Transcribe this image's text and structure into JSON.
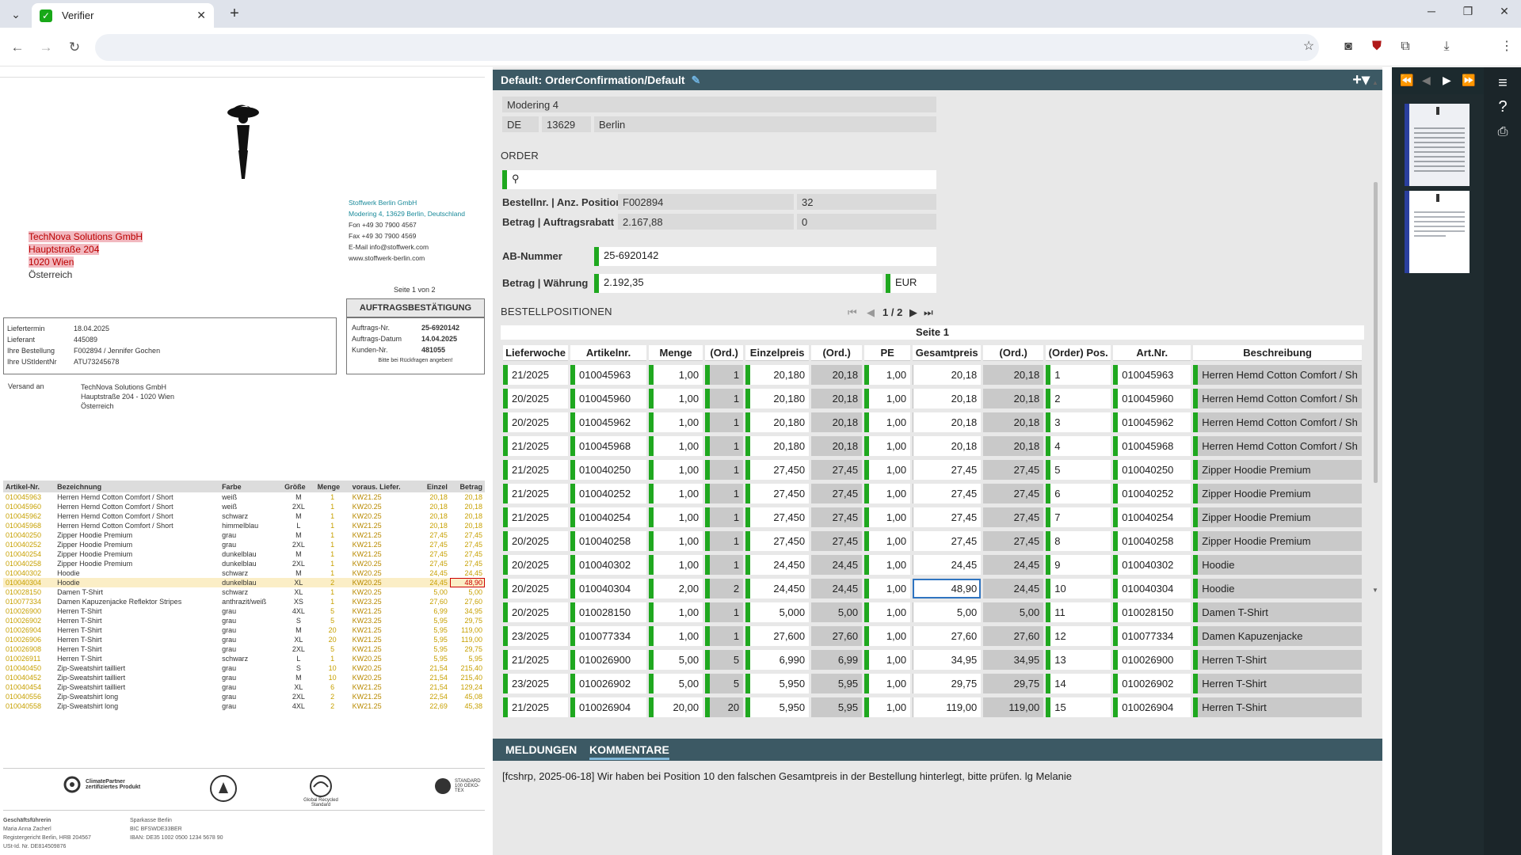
{
  "browser": {
    "tab_title": "Verifier",
    "tab_close": "✕",
    "new_tab": "+"
  },
  "document": {
    "supplier": {
      "name": "Stoffwerk Berlin GmbH",
      "address": "Modering 4, 13629 Berlin, Deutschland",
      "fon": "Fon +49 30 7900 4567",
      "fax": "Fax +49 30 7900 4569",
      "email": "E-Mail info@stoffwerk.com",
      "web": "www.stoffwerk-berlin.com"
    },
    "recipient": [
      "TechNova Solutions GmbH",
      "Hauptstraße 204",
      "1020 Wien",
      "Österreich"
    ],
    "page_info": "Seite 1 von 2",
    "doc_title": "AUFTRAGSBESTÄTIGUNG",
    "left_fields": [
      {
        "label": "Liefertermin",
        "value": "18.04.2025"
      },
      {
        "label": "Lieferant",
        "value": "445089"
      },
      {
        "label": "Ihre Bestellung",
        "value": "F002894 / Jennifer Gochen"
      },
      {
        "label": "Ihre UStIdentNr",
        "value": "ATU73245678"
      }
    ],
    "right_fields": [
      {
        "label": "Auftrags-Nr.",
        "value": "25-6920142"
      },
      {
        "label": "Auftrags-Datum",
        "value": "14.04.2025"
      },
      {
        "label": "Kunden-Nr.",
        "value": "481055"
      }
    ],
    "right_note": "Bitte bei Rückfragen angeben!",
    "ship_label": "Versand an",
    "ship_lines": [
      "TechNova Solutions GmbH",
      "Hauptstraße 204 - 1020 Wien",
      "Österreich"
    ],
    "table_headers": [
      "Artikel-Nr.",
      "Bezeichnung",
      "Farbe",
      "Größe",
      "Menge",
      "voraus. Liefer.",
      "Einzel",
      "Betrag"
    ],
    "rows": [
      [
        "010045963",
        "Herren Hemd Cotton Comfort / Short",
        "weiß",
        "M",
        "1",
        "KW21.25",
        "20,18",
        "20,18"
      ],
      [
        "010045960",
        "Herren Hemd Cotton Comfort / Short",
        "weiß",
        "2XL",
        "1",
        "KW20.25",
        "20,18",
        "20,18"
      ],
      [
        "010045962",
        "Herren Hemd Cotton Comfort / Short",
        "schwarz",
        "M",
        "1",
        "KW20.25",
        "20,18",
        "20,18"
      ],
      [
        "010045968",
        "Herren Hemd Cotton Comfort / Short",
        "himmelblau",
        "L",
        "1",
        "KW21.25",
        "20,18",
        "20,18"
      ],
      [
        "010040250",
        "Zipper Hoodie Premium",
        "grau",
        "M",
        "1",
        "KW21.25",
        "27,45",
        "27,45"
      ],
      [
        "010040252",
        "Zipper Hoodie Premium",
        "grau",
        "2XL",
        "1",
        "KW21.25",
        "27,45",
        "27,45"
      ],
      [
        "010040254",
        "Zipper Hoodie Premium",
        "dunkelblau",
        "M",
        "1",
        "KW21.25",
        "27,45",
        "27,45"
      ],
      [
        "010040258",
        "Zipper Hoodie Premium",
        "dunkelblau",
        "2XL",
        "1",
        "KW20.25",
        "27,45",
        "27,45"
      ],
      [
        "010040302",
        "Hoodie",
        "schwarz",
        "M",
        "1",
        "KW20.25",
        "24,45",
        "24,45"
      ],
      [
        "010040304",
        "Hoodie",
        "dunkelblau",
        "XL",
        "2",
        "KW20.25",
        "24,45",
        "48,90"
      ],
      [
        "010028150",
        "Damen T-Shirt",
        "schwarz",
        "XL",
        "1",
        "KW20.25",
        "5,00",
        "5,00"
      ],
      [
        "010077334",
        "Damen Kapuzenjacke Reflektor Stripes",
        "anthrazit/weiß",
        "XS",
        "1",
        "KW23.25",
        "27,60",
        "27,60"
      ],
      [
        "010026900",
        "Herren T-Shirt",
        "grau",
        "4XL",
        "5",
        "KW21.25",
        "6,99",
        "34,95"
      ],
      [
        "010026902",
        "Herren T-Shirt",
        "grau",
        "S",
        "5",
        "KW23.25",
        "5,95",
        "29,75"
      ],
      [
        "010026904",
        "Herren T-Shirt",
        "grau",
        "M",
        "20",
        "KW21.25",
        "5,95",
        "119,00"
      ],
      [
        "010026906",
        "Herren T-Shirt",
        "grau",
        "XL",
        "20",
        "KW21.25",
        "5,95",
        "119,00"
      ],
      [
        "010026908",
        "Herren T-Shirt",
        "grau",
        "2XL",
        "5",
        "KW21.25",
        "5,95",
        "29,75"
      ],
      [
        "010026911",
        "Herren T-Shirt",
        "schwarz",
        "L",
        "1",
        "KW20.25",
        "5,95",
        "5,95"
      ],
      [
        "010040450",
        "Zip-Sweatshirt tailliert",
        "grau",
        "S",
        "10",
        "KW20.25",
        "21,54",
        "215,40"
      ],
      [
        "010040452",
        "Zip-Sweatshirt tailliert",
        "grau",
        "M",
        "10",
        "KW20.25",
        "21,54",
        "215,40"
      ],
      [
        "010040454",
        "Zip-Sweatshirt tailliert",
        "grau",
        "XL",
        "6",
        "KW21.25",
        "21,54",
        "129,24"
      ],
      [
        "010040556",
        "Zip-Sweatshirt long",
        "grau",
        "2XL",
        "2",
        "KW21.25",
        "22,54",
        "45,08"
      ],
      [
        "010040558",
        "Zip-Sweatshirt long",
        "grau",
        "4XL",
        "2",
        "KW21.25",
        "22,69",
        "45,38"
      ]
    ],
    "logos": [
      "ClimatePartner zertifiziertes Produkt",
      "Global Recycled Standard",
      "STANDARD 100 OEKO-TEX"
    ],
    "footer_left": [
      "Geschäftsführerin",
      "Maria Anna Zacherl",
      "Registergericht Berlin, HRB 204567",
      "USt-Id. Nr. DE814509876"
    ],
    "footer_right": [
      "Sparkasse Berlin",
      "BIC BFSWDE33BER",
      "IBAN: DE35 1002 0500 1234 5678 90"
    ]
  },
  "panel": {
    "title": "Default: OrderConfirmation/Default",
    "address": {
      "street": "Modering 4",
      "country": "DE",
      "zip": "13629",
      "city": "Berlin"
    },
    "order_section": "ORDER",
    "bestell_label": "Bestellnr. | Anz. Positionen",
    "bestell_nr": "F002894",
    "anz_positionen": "32",
    "betrag_label": "Betrag | Auftragsrabatt",
    "betrag": "2.167,88",
    "rabatt": "0",
    "ab_label": "AB-Nummer",
    "ab_value": "25-6920142",
    "bw_label": "Betrag | Währung",
    "bw_value": "2.192,35",
    "currency": "EUR",
    "positions_section": "BESTELLPOSITIONEN",
    "pager": "1 / 2",
    "page_label": "Seite 1",
    "headers": [
      "Lieferwoche",
      "Artikelnr.",
      "Menge",
      "(Ord.)",
      "Einzelpreis",
      "(Ord.)",
      "PE",
      "Gesamtpreis",
      "(Ord.)",
      "(Order) Pos.",
      "Art.Nr.",
      "Beschreibung"
    ],
    "rows": [
      [
        "21/2025",
        "010045963",
        "1,00",
        "1",
        "20,180",
        "20,18",
        "1,00",
        "20,18",
        "20,18",
        "1",
        "010045963",
        "Herren Hemd Cotton  Comfort / Sh"
      ],
      [
        "20/2025",
        "010045960",
        "1,00",
        "1",
        "20,180",
        "20,18",
        "1,00",
        "20,18",
        "20,18",
        "2",
        "010045960",
        "Herren Hemd Cotton  Comfort / Sh"
      ],
      [
        "20/2025",
        "010045962",
        "1,00",
        "1",
        "20,180",
        "20,18",
        "1,00",
        "20,18",
        "20,18",
        "3",
        "010045962",
        "Herren Hemd Cotton  Comfort / Sh"
      ],
      [
        "21/2025",
        "010045968",
        "1,00",
        "1",
        "20,180",
        "20,18",
        "1,00",
        "20,18",
        "20,18",
        "4",
        "010045968",
        "Herren Hemd Cotton  Comfort / Sh"
      ],
      [
        "21/2025",
        "010040250",
        "1,00",
        "1",
        "27,450",
        "27,45",
        "1,00",
        "27,45",
        "27,45",
        "5",
        "010040250",
        "Zipper Hoodie Premium"
      ],
      [
        "21/2025",
        "010040252",
        "1,00",
        "1",
        "27,450",
        "27,45",
        "1,00",
        "27,45",
        "27,45",
        "6",
        "010040252",
        "Zipper Hoodie Premium"
      ],
      [
        "21/2025",
        "010040254",
        "1,00",
        "1",
        "27,450",
        "27,45",
        "1,00",
        "27,45",
        "27,45",
        "7",
        "010040254",
        "Zipper Hoodie Premium"
      ],
      [
        "20/2025",
        "010040258",
        "1,00",
        "1",
        "27,450",
        "27,45",
        "1,00",
        "27,45",
        "27,45",
        "8",
        "010040258",
        "Zipper Hoodie Premium"
      ],
      [
        "20/2025",
        "010040302",
        "1,00",
        "1",
        "24,450",
        "24,45",
        "1,00",
        "24,45",
        "24,45",
        "9",
        "010040302",
        "Hoodie"
      ],
      [
        "20/2025",
        "010040304",
        "2,00",
        "2",
        "24,450",
        "24,45",
        "1,00",
        "48,90",
        "24,45",
        "10",
        "010040304",
        "Hoodie"
      ],
      [
        "20/2025",
        "010028150",
        "1,00",
        "1",
        "5,000",
        "5,00",
        "1,00",
        "5,00",
        "5,00",
        "11",
        "010028150",
        "Damen T-Shirt"
      ],
      [
        "23/2025",
        "010077334",
        "1,00",
        "1",
        "27,600",
        "27,60",
        "1,00",
        "27,60",
        "27,60",
        "12",
        "010077334",
        "Damen Kapuzenjacke"
      ],
      [
        "21/2025",
        "010026900",
        "5,00",
        "5",
        "6,990",
        "6,99",
        "1,00",
        "34,95",
        "34,95",
        "13",
        "010026900",
        "Herren T-Shirt"
      ],
      [
        "23/2025",
        "010026902",
        "5,00",
        "5",
        "5,950",
        "5,95",
        "1,00",
        "29,75",
        "29,75",
        "14",
        "010026902",
        "Herren T-Shirt"
      ],
      [
        "21/2025",
        "010026904",
        "20,00",
        "20",
        "5,950",
        "5,95",
        "1,00",
        "119,00",
        "119,00",
        "15",
        "010026904",
        "Herren T-Shirt"
      ]
    ],
    "tabs": [
      "MELDUNGEN",
      "KOMMENTARE"
    ],
    "comment": "[fcshrp, 2025-06-18] Wir haben bei Position 10 den falschen Gesamtpreis in der Bestellung hinterlegt, bitte prüfen. lg Melanie"
  },
  "colors": {
    "header": "#3c5964",
    "green": "#1fa81f",
    "highlight": "#2f74c0"
  }
}
